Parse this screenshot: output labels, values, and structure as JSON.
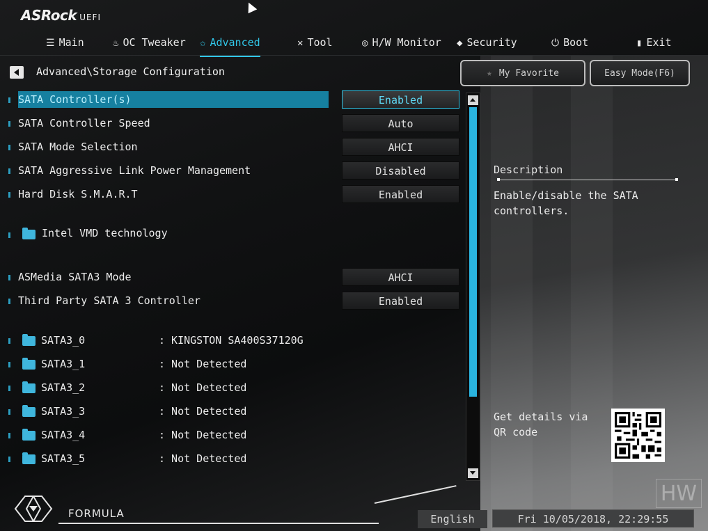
{
  "header": {
    "brand": "ASRock",
    "brand_suffix": "UEFI"
  },
  "nav": [
    {
      "label": "Main",
      "icon": "list-icon"
    },
    {
      "label": "OC Tweaker",
      "icon": "flame-icon"
    },
    {
      "label": "Advanced",
      "icon": "star-icon",
      "active": true
    },
    {
      "label": "Tool",
      "icon": "tools-icon"
    },
    {
      "label": "H/W Monitor",
      "icon": "monitor-icon"
    },
    {
      "label": "Security",
      "icon": "shield-icon"
    },
    {
      "label": "Boot",
      "icon": "power-icon"
    },
    {
      "label": "Exit",
      "icon": "exit-icon"
    }
  ],
  "breadcrumb": "Advanced\\Storage Configuration",
  "buttons": {
    "favorite": "My Favorite",
    "easy_mode": "Easy Mode(F6)"
  },
  "settings": [
    {
      "label": "SATA Controller(s)",
      "value": "Enabled",
      "selected": true
    },
    {
      "label": "SATA Controller Speed",
      "value": "Auto"
    },
    {
      "label": "SATA Mode Selection",
      "value": "AHCI"
    },
    {
      "label": "SATA Aggressive Link Power Management",
      "value": "Disabled"
    },
    {
      "label": "Hard Disk S.M.A.R.T",
      "value": "Enabled"
    }
  ],
  "submenu_vmd": "Intel VMD technology",
  "settings2": [
    {
      "label": "ASMedia SATA3 Mode",
      "value": "AHCI"
    },
    {
      "label": "Third Party SATA 3 Controller",
      "value": "Enabled"
    }
  ],
  "devices": [
    {
      "name": "SATA3_0",
      "value": ": KINGSTON SA400S37120G"
    },
    {
      "name": "SATA3_1",
      "value": ": Not Detected"
    },
    {
      "name": "SATA3_2",
      "value": ": Not Detected"
    },
    {
      "name": "SATA3_3",
      "value": ": Not Detected"
    },
    {
      "name": "SATA3_4",
      "value": ": Not Detected"
    },
    {
      "name": "SATA3_5",
      "value": ": Not Detected"
    }
  ],
  "description": {
    "title": "Description",
    "text": "Enable/disable the SATA controllers.",
    "qr_text": "Get details via QR code"
  },
  "footer": {
    "formula": "FORMULA",
    "language": "English",
    "datetime": "Fri 10/05/2018, 22:29:55",
    "watermark": "HW"
  },
  "colors": {
    "accent": "#31c6e8",
    "selected_row": "#1680a0",
    "scroll_thumb": "#2ab3de"
  }
}
